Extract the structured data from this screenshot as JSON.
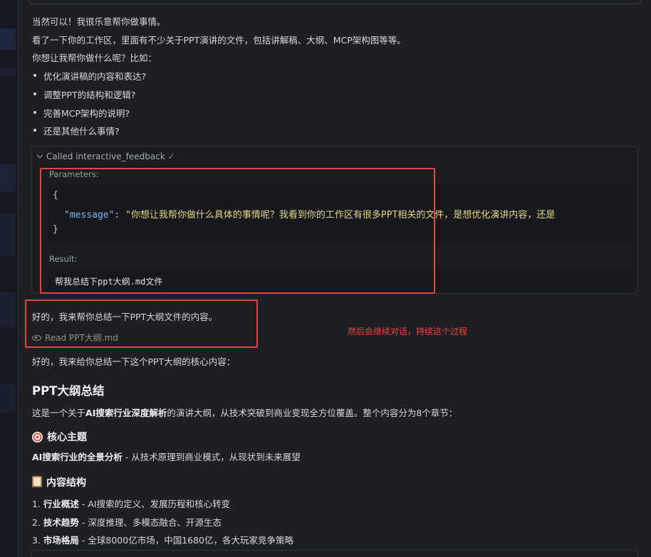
{
  "intro": {
    "line1": "当然可以！我很乐意帮你做事情。",
    "line2": "看了一下你的工作区，里面有不少关于PPT演讲的文件，包括讲解稿、大纲、MCP架构图等等。",
    "line3": "你想让我帮你做什么呢？比如：",
    "bullets": [
      "优化演讲稿的内容和表达?",
      "调整PPT的结构和逻辑?",
      "完善MCP架构的说明?",
      "还是其他什么事情?"
    ]
  },
  "tool_call": {
    "header": "Called interactive_feedback",
    "check_icon": "✓",
    "params_label": "Parameters:",
    "brace_open": "{",
    "key": "\"message\"",
    "colon": ": ",
    "value": "\"你想让我帮你做什么具体的事情呢？我看到你的工作区有很多PPT相关的文件，是想优化演讲内容，还是",
    "brace_close": "}",
    "result_label": "Result:",
    "result_text": "帮我总结下ppt大纲.md文件"
  },
  "reply1": "好的，我来帮你总结一下PPT大纲文件的内容。",
  "read_file": "Read PPT大纲.md",
  "annotation": "然后会继续对话，持续这个过程",
  "reply2": "好的，我来给你总结一下这个PPT大纲的核心内容：",
  "summary": {
    "title": "PPT大纲总结",
    "desc_pre": "这是一个关于",
    "desc_bold": "AI搜索行业深度解析",
    "desc_post": "的演讲大纲，从技术突破到商业变现全方位覆盖。整个内容分为8个章节：",
    "core_heading": "核心主题",
    "core_bold": "AI搜索行业的全景分析",
    "core_rest": " - 从技术原理到商业模式，从现状到未来展望",
    "structure_heading": "内容结构",
    "items": [
      {
        "num": "1. ",
        "bold": "行业概述",
        "rest": " - AI搜索的定义、发展历程和核心转变"
      },
      {
        "num": "2. ",
        "bold": "技术趋势",
        "rest": " - 深度推理、多模态融合、开源生态"
      },
      {
        "num": "3. ",
        "bold": "市场格局",
        "rest": " - 全球8000亿市场，中国1680亿，各大玩家竞争策略"
      }
    ]
  },
  "colors": {
    "accent_red": "#e2453d",
    "json_key": "#7cb7f0",
    "json_string": "#e4d58a"
  }
}
